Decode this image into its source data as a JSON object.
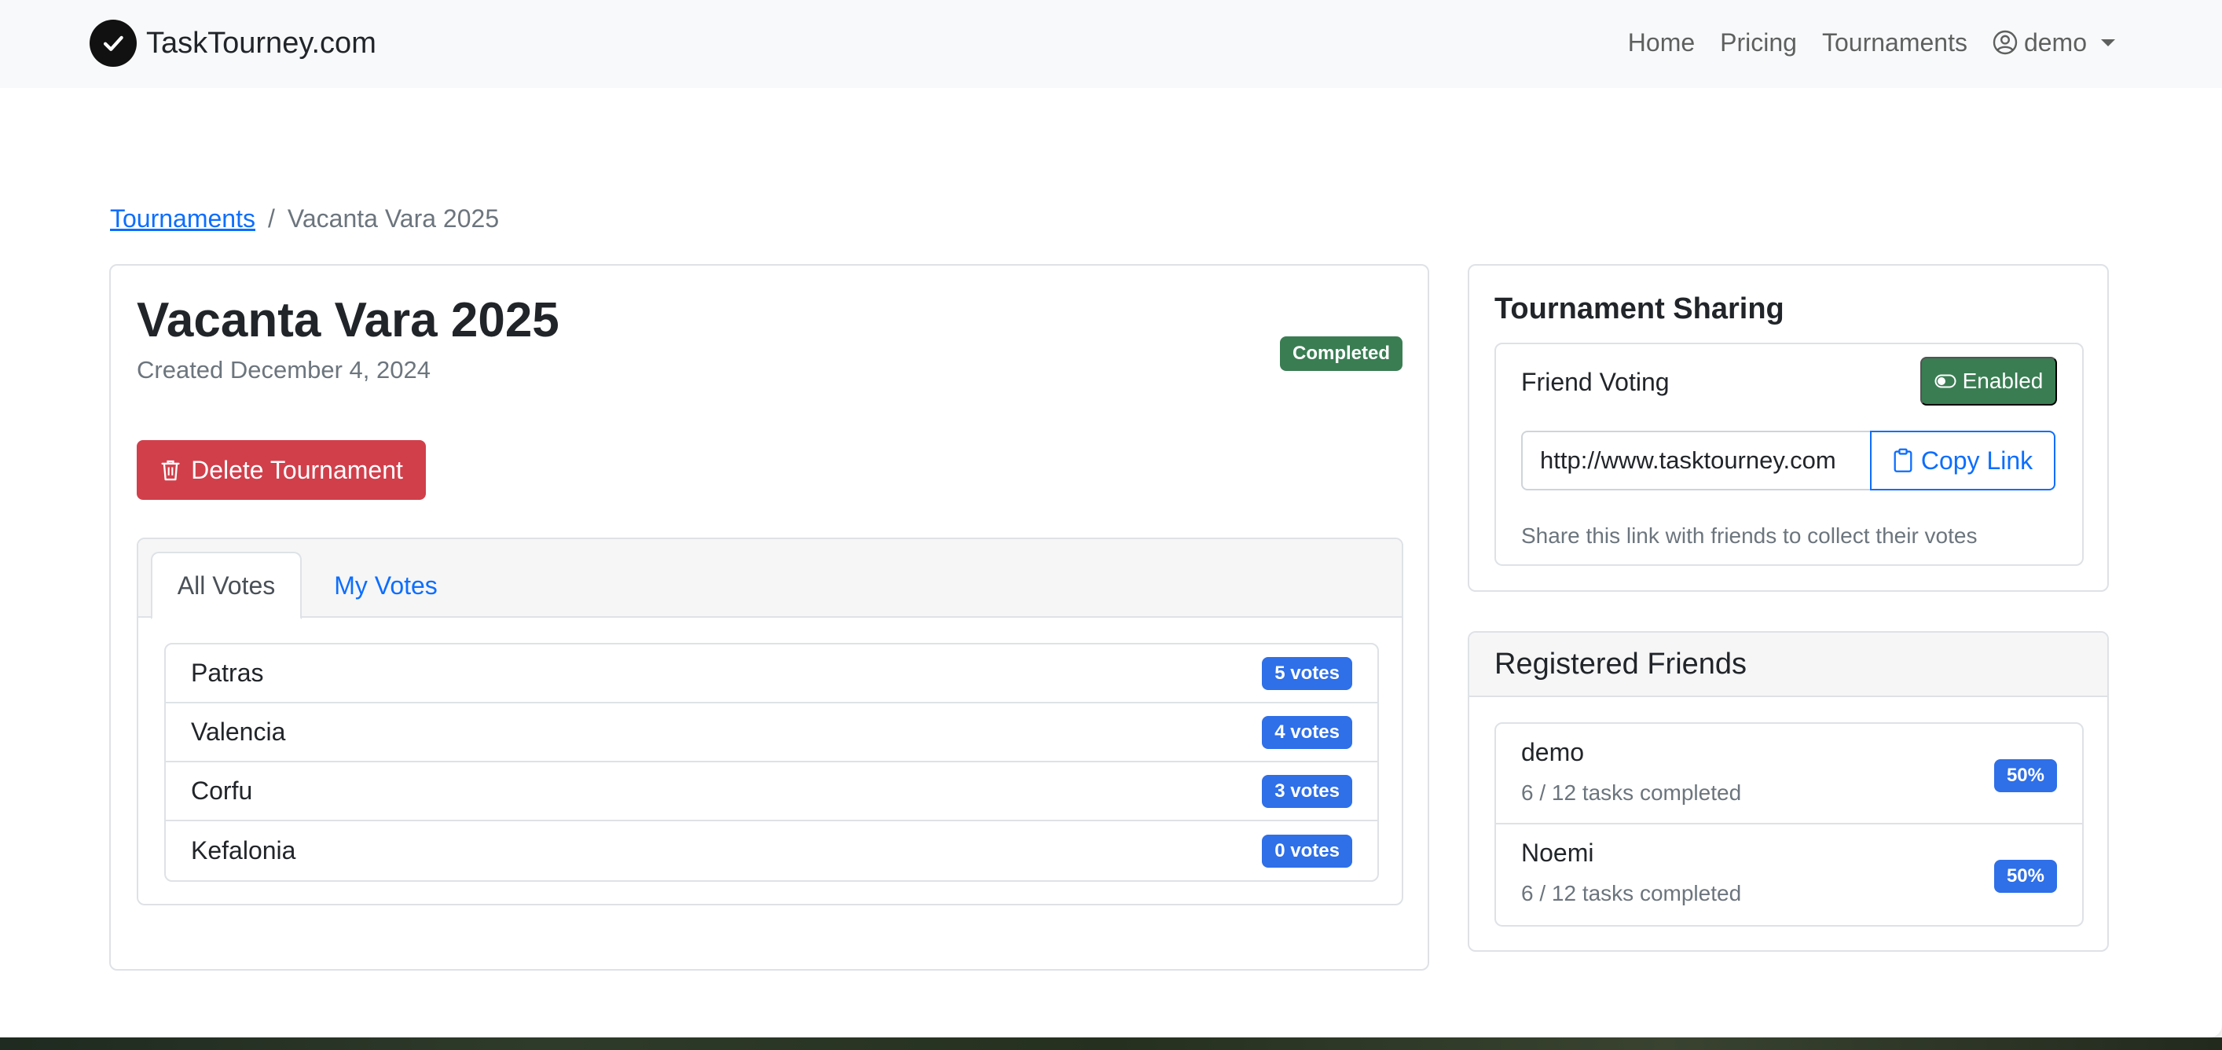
{
  "navbar": {
    "brand": "TaskTourney.com",
    "links": [
      "Home",
      "Pricing",
      "Tournaments"
    ],
    "user": "demo"
  },
  "breadcrumb": {
    "parent": "Tournaments",
    "separator": "/",
    "current": "Vacanta Vara 2025"
  },
  "tournament": {
    "title": "Vacanta Vara 2025",
    "created": "Created December 4, 2024",
    "status": "Completed",
    "delete_label": "Delete Tournament"
  },
  "votes": {
    "tabs": [
      "All Votes",
      "My Votes"
    ],
    "items": [
      {
        "name": "Patras",
        "count": "5 votes"
      },
      {
        "name": "Valencia",
        "count": "4 votes"
      },
      {
        "name": "Corfu",
        "count": "3 votes"
      },
      {
        "name": "Kefalonia",
        "count": "0 votes"
      }
    ]
  },
  "sharing": {
    "title": "Tournament Sharing",
    "friend_voting_label": "Friend Voting",
    "enabled_label": "Enabled",
    "link": "http://www.tasktourney.com",
    "copy_label": "Copy Link",
    "help": "Share this link with friends to collect their votes"
  },
  "friends": {
    "title": "Registered Friends",
    "items": [
      {
        "name": "demo",
        "progress": "6 / 12 tasks completed",
        "percent": "50%"
      },
      {
        "name": "Noemi",
        "progress": "6 / 12 tasks completed",
        "percent": "50%"
      }
    ]
  },
  "colors": {
    "primary": "#0d6efd",
    "success": "#3a7d53",
    "danger": "#d13f4b",
    "badge_blue": "#2f6fe8"
  }
}
